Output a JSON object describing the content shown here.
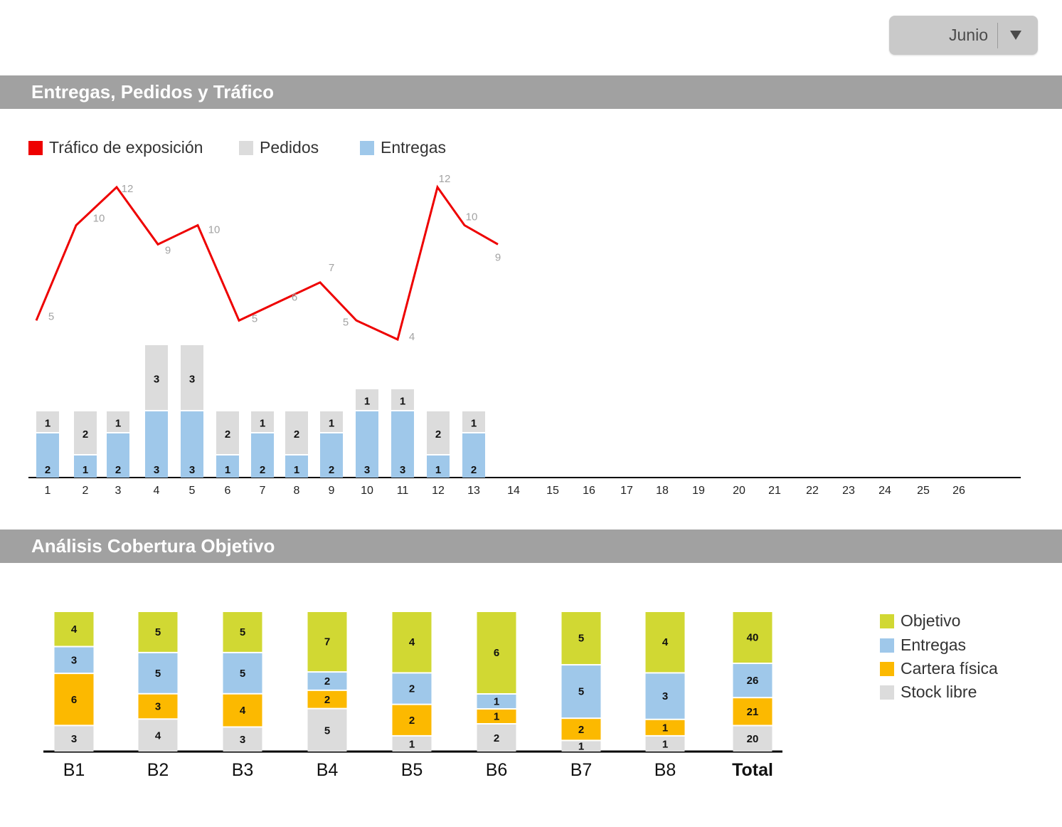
{
  "dropdown": {
    "selected": "Junio"
  },
  "sections": {
    "trafico_title": "Entregas, Pedidos y Tráfico",
    "cobertura_title": "Análisis Cobertura Objetivo"
  },
  "colors": {
    "trafico": "#ee0000",
    "pedidos": "#dcdcdc",
    "entregas": "#9fc8ea",
    "objetivo": "#d1d833",
    "cartera": "#fcb900",
    "stock": "#dcdcdc",
    "header": "#a1a1a1"
  },
  "legend1": [
    {
      "label": "Tráfico de exposición",
      "color": "#ee0000"
    },
    {
      "label": "Pedidos",
      "color": "#dcdcdc"
    },
    {
      "label": "Entregas",
      "color": "#9fc8ea"
    }
  ],
  "legend2": [
    {
      "label": "Objetivo",
      "color": "#d1d833"
    },
    {
      "label": "Entregas",
      "color": "#9fc8ea"
    },
    {
      "label": "Cartera física",
      "color": "#fcb900"
    },
    {
      "label": "Stock libre",
      "color": "#dcdcdc"
    }
  ],
  "chart_data": [
    {
      "type": "bar",
      "stacked": true,
      "categories": [
        "1",
        "2",
        "3",
        "4",
        "5",
        "6",
        "7",
        "8",
        "9",
        "10",
        "11",
        "12",
        "13",
        "14",
        "15",
        "16",
        "17",
        "18",
        "19",
        "20",
        "21",
        "22",
        "23",
        "24",
        "25",
        "26"
      ],
      "series": [
        {
          "name": "Entregas",
          "values": [
            2,
            1,
            2,
            3,
            3,
            1,
            2,
            1,
            2,
            3,
            3,
            1,
            2
          ]
        },
        {
          "name": "Pedidos",
          "values": [
            1,
            2,
            1,
            3,
            3,
            2,
            1,
            2,
            1,
            1,
            1,
            2,
            1
          ]
        },
        {
          "name": "Tráfico de exposición",
          "type": "line",
          "values": [
            5,
            10,
            12,
            9,
            10,
            5,
            6,
            7,
            5,
            4,
            12,
            10,
            9
          ]
        }
      ],
      "legend": "top-left",
      "grid": false
    },
    {
      "type": "bar",
      "stacked": true,
      "categories": [
        "B1",
        "B2",
        "B3",
        "B4",
        "B5",
        "B6",
        "B7",
        "B8",
        "Total"
      ],
      "series": [
        {
          "name": "Stock libre",
          "values": [
            3,
            4,
            3,
            5,
            1,
            2,
            1,
            1,
            20
          ]
        },
        {
          "name": "Cartera física",
          "values": [
            6,
            3,
            4,
            2,
            2,
            1,
            2,
            1,
            21
          ]
        },
        {
          "name": "Entregas",
          "values": [
            3,
            5,
            5,
            2,
            2,
            1,
            5,
            3,
            26
          ]
        },
        {
          "name": "Objetivo",
          "values": [
            4,
            5,
            5,
            7,
            4,
            6,
            5,
            4,
            40
          ]
        }
      ],
      "legend": "right",
      "grid": false
    }
  ]
}
